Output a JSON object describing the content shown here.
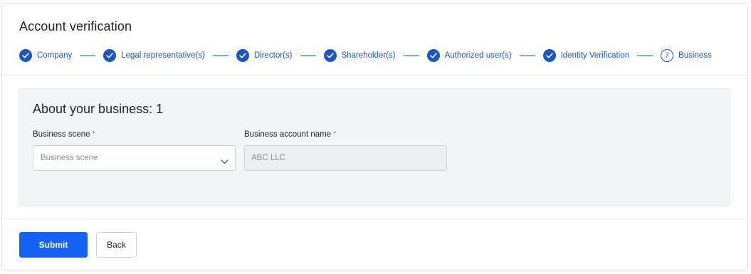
{
  "page": {
    "title": "Account verification"
  },
  "stepper": {
    "steps": [
      {
        "label": "Company",
        "state": "done"
      },
      {
        "label": "Legal representative(s)",
        "state": "done"
      },
      {
        "label": "Director(s)",
        "state": "done"
      },
      {
        "label": "Shareholder(s)",
        "state": "done"
      },
      {
        "label": "Authorized user(s)",
        "state": "done"
      },
      {
        "label": "Identity Verification",
        "state": "done"
      },
      {
        "label": "Business",
        "state": "current",
        "number": "7"
      }
    ]
  },
  "section": {
    "title": "About your business: 1",
    "business_scene": {
      "label": "Business scene",
      "required_mark": "*",
      "placeholder": "Business scene",
      "icon": "chevron-down-icon"
    },
    "business_account_name": {
      "label": "Business account name",
      "required_mark": "*",
      "value": "ABC LLC",
      "disabled": true
    }
  },
  "actions": {
    "submit_label": "Submit",
    "back_label": "Back"
  },
  "colors": {
    "accent": "#1a56c9",
    "primary_button": "#1663f2",
    "required": "#e03e3e"
  }
}
